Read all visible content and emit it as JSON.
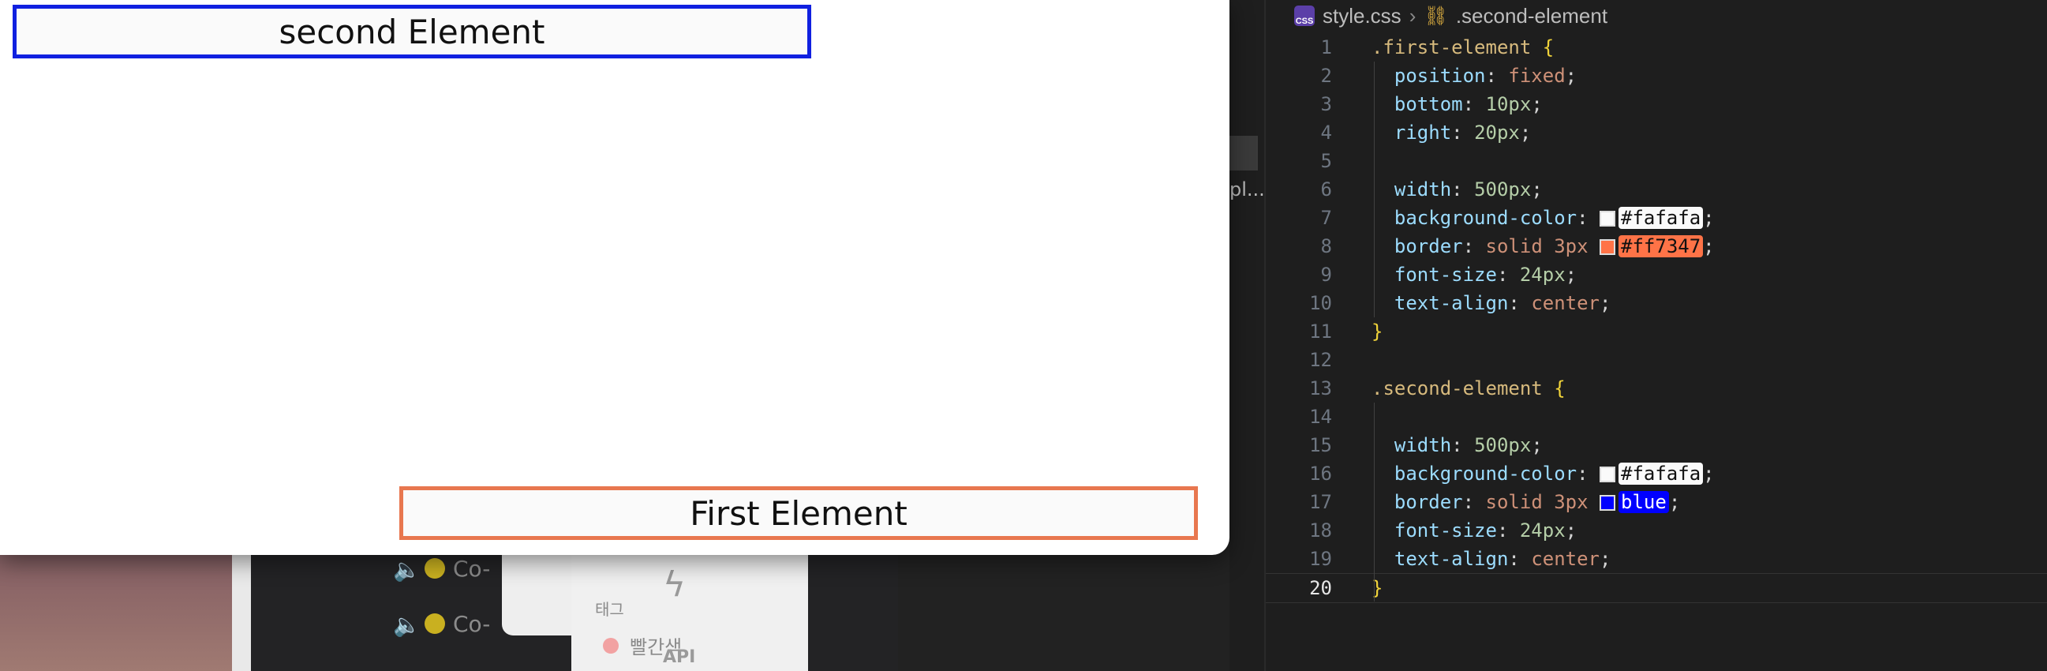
{
  "preview": {
    "second_element_text": "second Element",
    "first_element_text": "First Element",
    "second_border_color": "#1020e0",
    "first_border_color": "#e8774f",
    "box_background": "#fafafa"
  },
  "background_app": {
    "row1_text": "Co-",
    "row2_text": "Co-",
    "tag_heading": "태그",
    "tag_item": "빨간색",
    "api_label": "API",
    "side_label": "pl..."
  },
  "editor": {
    "breadcrumb": {
      "file": "style.css",
      "selector": ".second-element"
    },
    "lines": [
      {
        "n": "1",
        "selector": ".first-element",
        "brace": "{"
      },
      {
        "n": "2",
        "prop": "position",
        "val": "fixed"
      },
      {
        "n": "3",
        "prop": "bottom",
        "num": "10px"
      },
      {
        "n": "4",
        "prop": "right",
        "num": "20px"
      },
      {
        "n": "5"
      },
      {
        "n": "6",
        "prop": "width",
        "num": "500px"
      },
      {
        "n": "7",
        "prop": "background-color",
        "color": "#fafafa"
      },
      {
        "n": "8",
        "prop": "border",
        "val": "solid 3px",
        "color": "#ff7347"
      },
      {
        "n": "9",
        "prop": "font-size",
        "num": "24px"
      },
      {
        "n": "10",
        "prop": "text-align",
        "val": "center"
      },
      {
        "n": "11",
        "brace": "}"
      },
      {
        "n": "12"
      },
      {
        "n": "13",
        "selector": ".second-element",
        "brace": "{"
      },
      {
        "n": "14"
      },
      {
        "n": "15",
        "prop": "width",
        "num": "500px"
      },
      {
        "n": "16",
        "prop": "background-color",
        "color": "#fafafa"
      },
      {
        "n": "17",
        "prop": "border",
        "val": "solid 3px",
        "color": "blue"
      },
      {
        "n": "18",
        "prop": "font-size",
        "num": "24px"
      },
      {
        "n": "19",
        "prop": "text-align",
        "val": "center"
      },
      {
        "n": "20",
        "brace": "}"
      }
    ],
    "active_line": "20"
  }
}
